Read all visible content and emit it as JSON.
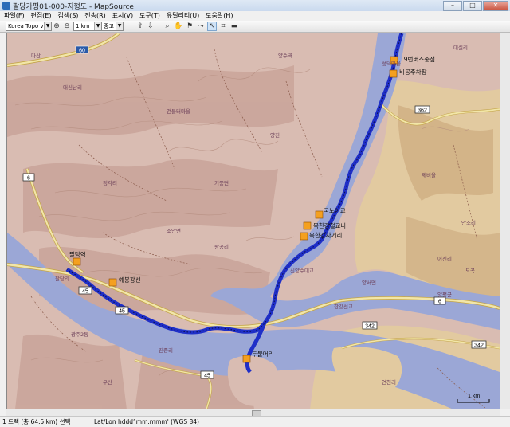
{
  "window": {
    "title": "팔당가평01-000-지형도 - MapSource",
    "min_label": "–",
    "max_label": "□",
    "close_label": "✕"
  },
  "menu": [
    "파일(F)",
    "편집(E)",
    "검색(S)",
    "전송(R)",
    "표시(V)",
    "도구(T)",
    "유틸리티(U)",
    "도움말(H)"
  ],
  "toolbar": {
    "map_product": "Korea Topo v9",
    "scale": "1 km",
    "detail": "중고"
  },
  "map": {
    "colors": {
      "land": "#d8b8ae",
      "water": "#9aa6d4",
      "route": "#2233cc",
      "road": "#f2e6a8",
      "road_edge": "#c4a54a",
      "contour": "#b48c7e"
    },
    "route_shields": [
      {
        "label": "60",
        "color": "#2b5aa8"
      },
      {
        "label": "6"
      },
      {
        "label": "6"
      },
      {
        "label": "45"
      },
      {
        "label": "45"
      },
      {
        "label": "45"
      },
      {
        "label": "342"
      },
      {
        "label": "342"
      },
      {
        "label": "362"
      }
    ],
    "waypoints": [
      "19번버스종점",
      "비공주차장",
      "국노이교",
      "북한강철교나",
      "북한강사거리",
      "팔당역",
      "예봉강선",
      "두물머리",
      "양수역",
      "건물터마을",
      "양진",
      "양평군",
      "제비울",
      "안소리",
      "어진리",
      "성덕마을",
      "신양수대교",
      "한강선교",
      "팔당리",
      "다산",
      "대신남리",
      "광주2동",
      "진중리",
      "양서면",
      "대실리",
      "조안면",
      "왕공리",
      "정각리",
      "연천리",
      "우산",
      "도곡",
      "기풍면"
    ],
    "scale_bar": "1 km"
  },
  "status": {
    "track_info": "1 트랙 (총 64.5 km) 선택",
    "coord_format": "Lat/Lon hddd°mm.mmm' (WGS 84)"
  }
}
